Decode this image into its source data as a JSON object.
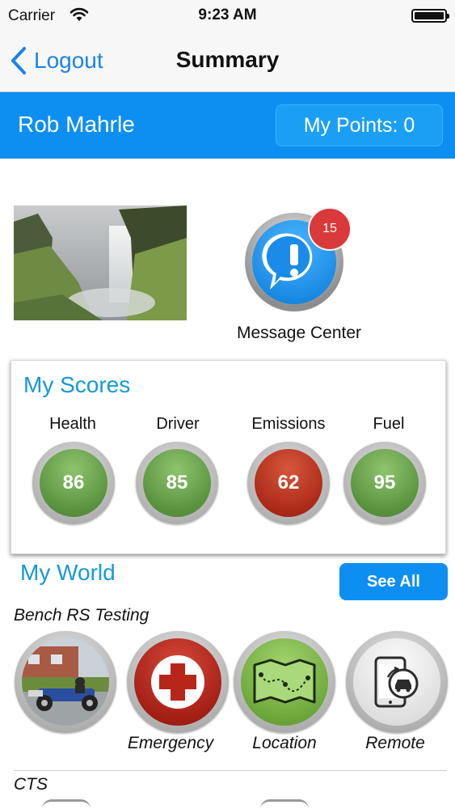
{
  "status_bar": {
    "carrier": "Carrier",
    "time": "9:23 AM"
  },
  "nav": {
    "back_label": "Logout",
    "title": "Summary"
  },
  "header": {
    "user_name": "Rob Mahrle",
    "points_label": "My Points: 0"
  },
  "message_center": {
    "label": "Message Center",
    "badge_count": "15"
  },
  "scores": {
    "title": "My Scores",
    "items": [
      {
        "label": "Health",
        "value": "86",
        "status": "green"
      },
      {
        "label": "Driver",
        "value": "85",
        "status": "green"
      },
      {
        "label": "Emissions",
        "value": "62",
        "status": "red"
      },
      {
        "label": "Fuel",
        "value": "95",
        "status": "green"
      }
    ]
  },
  "world": {
    "title": "My World",
    "see_all_label": "See All",
    "vehicles": [
      {
        "name": "Bench RS Testing",
        "actions": [
          {
            "label": "",
            "icon": "vehicle-photo"
          },
          {
            "label": "Emergency",
            "icon": "medical-cross-icon"
          },
          {
            "label": "Location",
            "icon": "map-route-icon"
          },
          {
            "label": "Remote",
            "icon": "phone-car-remote-icon"
          }
        ]
      },
      {
        "name": "CTS"
      }
    ]
  },
  "colors": {
    "accent_blue": "#0d8ff2",
    "title_blue": "#1599d7",
    "score_green": "#5a933f",
    "score_red": "#ad2a18",
    "badge_red": "#d9393a"
  }
}
